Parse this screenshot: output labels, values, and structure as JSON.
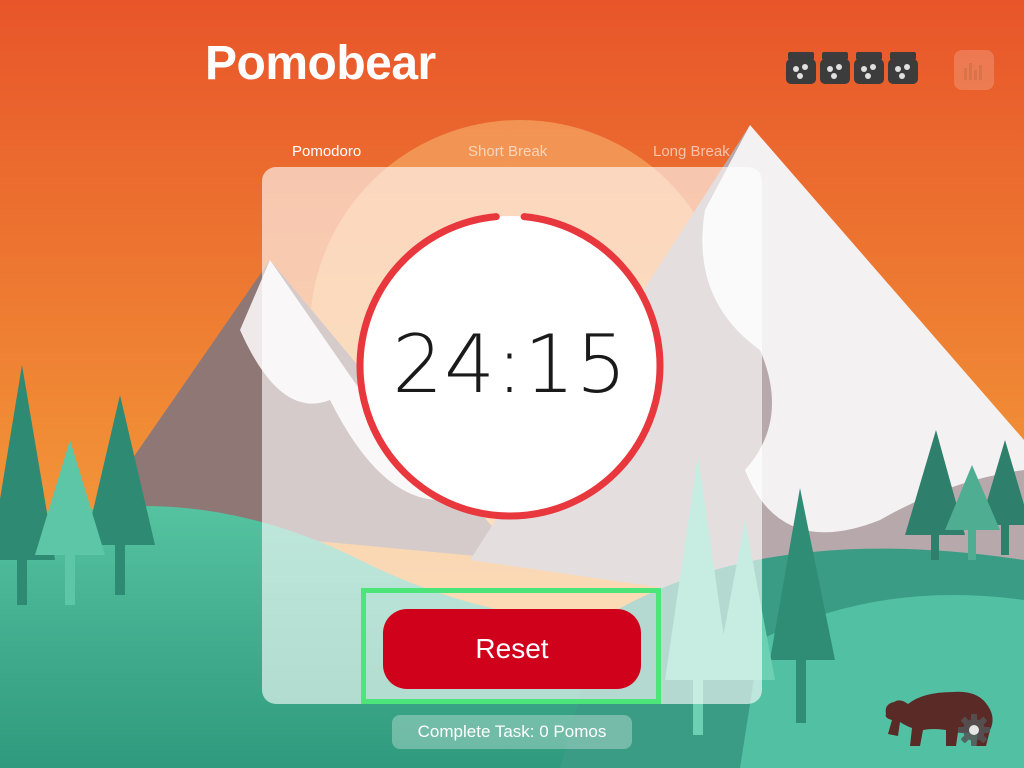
{
  "app": {
    "title": "Pomobear"
  },
  "header": {
    "jar_icons": [
      "jar-icon",
      "jar-icon",
      "jar-icon",
      "jar-icon"
    ],
    "stats_icon": "bar-chart-icon"
  },
  "tabs": [
    {
      "label": "Pomodoro",
      "active": true
    },
    {
      "label": "Short Break",
      "active": false
    },
    {
      "label": "Long Break",
      "active": false
    }
  ],
  "timer": {
    "time": "24:15",
    "progress_remaining": 0.97,
    "ring_color": "#e8373d"
  },
  "controls": {
    "reset_label": "Reset",
    "reset_color": "#d0021b"
  },
  "footer": {
    "complete_task_label": "Complete Task: 0 Pomos",
    "settings_icon": "gear-icon",
    "mascot_icon": "bear-icon"
  },
  "colors": {
    "sky_top": "#e85a2c",
    "sky_bottom": "#f4a23c",
    "hill": "#3fae8f",
    "accent": "#4be57a"
  }
}
